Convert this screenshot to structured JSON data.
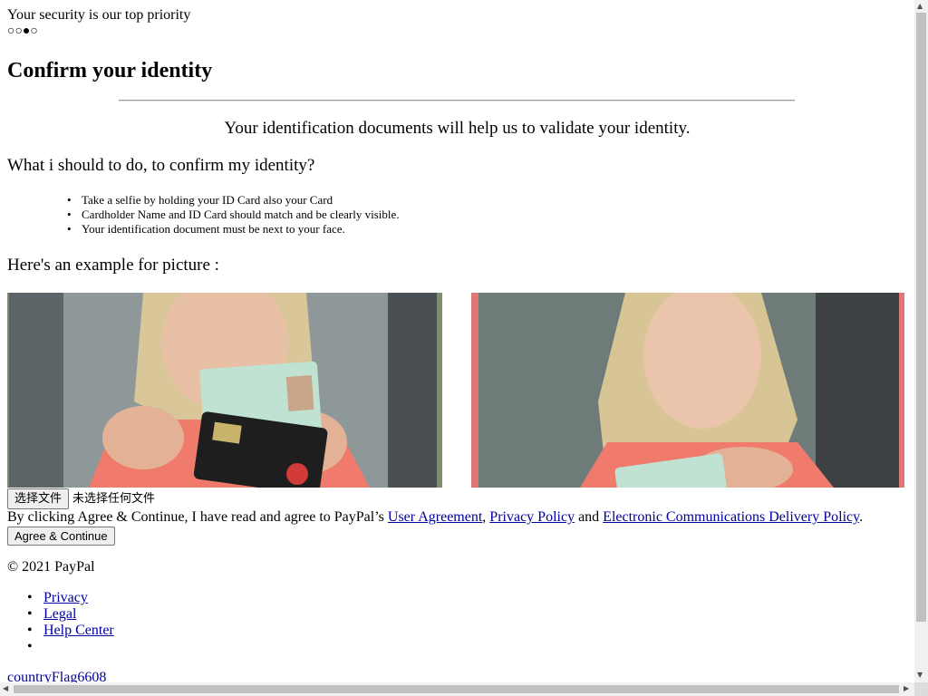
{
  "header": {
    "security_text": "Your security is our top priority",
    "progress_dots": "○○●○"
  },
  "main": {
    "title": "Confirm your identity",
    "intro": "Your identification documents will help us to validate your identity.",
    "question": "What i should to do, to confirm my identity?",
    "steps": [
      "Take a selfie by holding your ID Card also your Card",
      "Cardholder Name and ID Card should match and be clearly visible.",
      "Your identification document must be next to your face."
    ],
    "example_label": "Here's an example for picture :",
    "example_image_1_desc": "Woman holding ID card and bank card",
    "example_image_2_desc": "Woman holding ID card next to face"
  },
  "upload": {
    "button_label": "选择文件",
    "status_text": "未选择任何文件"
  },
  "consent": {
    "prefix": "By clicking Agree & Continue, I have read and agree to PayPal’s ",
    "user_agreement": "User Agreement",
    "sep1": ", ",
    "privacy_policy": "Privacy Policy",
    "sep2": " and ",
    "ecd_policy": "Electronic Communications Delivery Policy",
    "suffix": "."
  },
  "agree_button": "Agree & Continue",
  "footer": {
    "copyright": "© 2021 PayPal",
    "links": [
      "Privacy",
      "Legal",
      "Help Center",
      ""
    ],
    "country_flag": "countryFlag6608"
  },
  "colors": {
    "link": "#00009c",
    "photo_frame_left": "#7d8f6e",
    "photo_frame_right": "#e07774"
  }
}
